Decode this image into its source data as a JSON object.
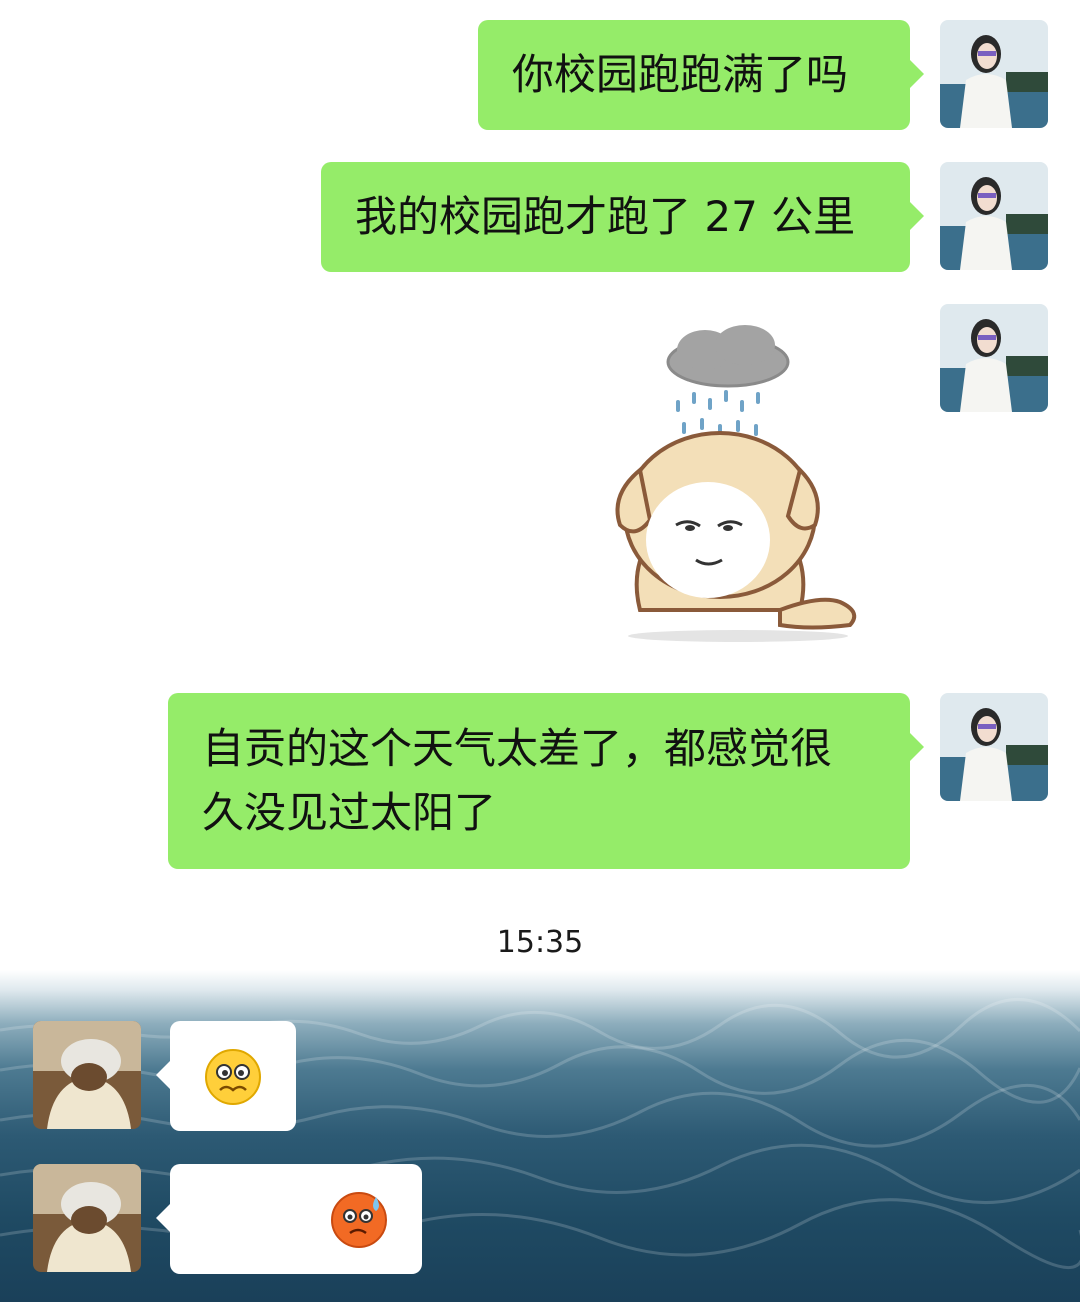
{
  "chat": {
    "messages": [
      {
        "sender": "me",
        "type": "text",
        "text": "你校园跑跑满了吗"
      },
      {
        "sender": "me",
        "type": "text",
        "text": "我的校园跑才跑了 27 公里"
      },
      {
        "sender": "me",
        "type": "sticker",
        "sticker": "rain-cloud-sad-dog-sticker"
      },
      {
        "sender": "me",
        "type": "text",
        "line1": "自贡的这个天气太差了，都感觉很",
        "line2": "久没见过太阳了"
      },
      {
        "sender": "other",
        "type": "emoji",
        "emoji": "worried-face-emoji"
      },
      {
        "sender": "other",
        "type": "emoji",
        "emoji": "sweat-face-emoji"
      }
    ],
    "timestamp": "15:35"
  },
  "colors": {
    "my_bubble": "#95ec69",
    "other_bubble": "#ffffff",
    "sea": "#1f4a63"
  }
}
